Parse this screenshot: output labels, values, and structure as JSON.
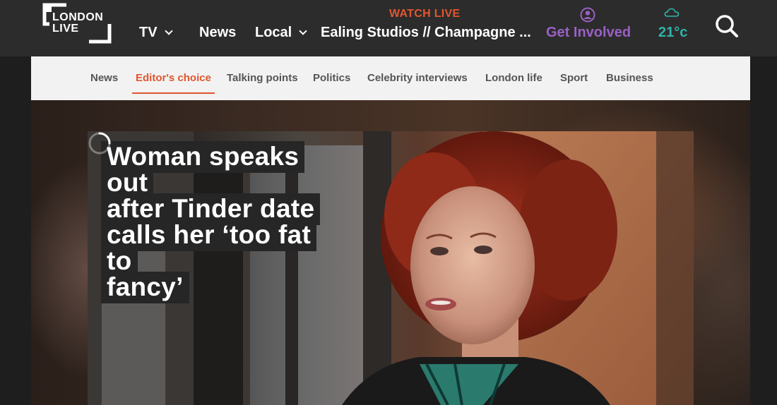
{
  "header": {
    "logo_line1": "LONDON",
    "logo_line2": "LIVE",
    "nav": [
      {
        "label": "TV",
        "has_dropdown": true
      },
      {
        "label": "News",
        "has_dropdown": false
      },
      {
        "label": "Local",
        "has_dropdown": true
      }
    ],
    "watch_live": {
      "label": "WATCH LIVE",
      "title": "Ealing Studios // Champagne ..."
    },
    "get_involved": {
      "label": "Get Involved",
      "icon": "user-circle-icon"
    },
    "weather": {
      "temperature": "21°c",
      "icon": "cloud-icon"
    },
    "search_icon": "search-icon"
  },
  "subnav": {
    "items": [
      {
        "label": "News",
        "active": false
      },
      {
        "label": "Editor's choice",
        "active": true
      },
      {
        "label": "Talking points",
        "active": false
      },
      {
        "label": "Politics",
        "active": false
      },
      {
        "label": "Celebrity interviews",
        "active": false
      },
      {
        "label": "London life",
        "active": false
      },
      {
        "label": "Sport",
        "active": false
      },
      {
        "label": "Business",
        "active": false
      }
    ]
  },
  "hero": {
    "headline_lines": [
      "Woman speaks out",
      "after Tinder date",
      "calls her ‘too fat to",
      "fancy’"
    ]
  },
  "colors": {
    "accent": "#e0562f",
    "purple": "#9a61c4",
    "teal": "#2fb4a7",
    "header_bg": "#2c2c2c",
    "subnav_bg": "#f2f2f2"
  }
}
